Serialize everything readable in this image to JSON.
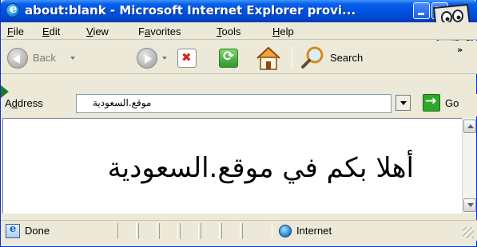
{
  "window": {
    "title": "about:blank - Microsoft Internet Explorer provi...",
    "title_icon": "ie-logo-icon"
  },
  "menu": {
    "items": [
      {
        "key": "F",
        "rest": "ile"
      },
      {
        "key": "E",
        "rest": "dit"
      },
      {
        "key": "V",
        "rest": "iew"
      },
      {
        "pre": "F",
        "key": "a",
        "rest": "vorites"
      },
      {
        "key": "T",
        "rest": "ools"
      },
      {
        "key": "H",
        "rest": "elp"
      }
    ]
  },
  "toolbar": {
    "back_label": "Back",
    "search_label": "Search",
    "chevrons": "»"
  },
  "address": {
    "label_pre": "A",
    "label_key": "d",
    "label_rest": "dress",
    "value": "موقع.السعودية",
    "go_label": "Go"
  },
  "content": {
    "heading": "أهلا بكم في موقع.السعودية"
  },
  "status": {
    "text": "Done",
    "zone": "Internet"
  },
  "colors": {
    "title_bar": "#0054e3",
    "chrome": "#ece9d8",
    "go_green": "#2ea82b"
  }
}
